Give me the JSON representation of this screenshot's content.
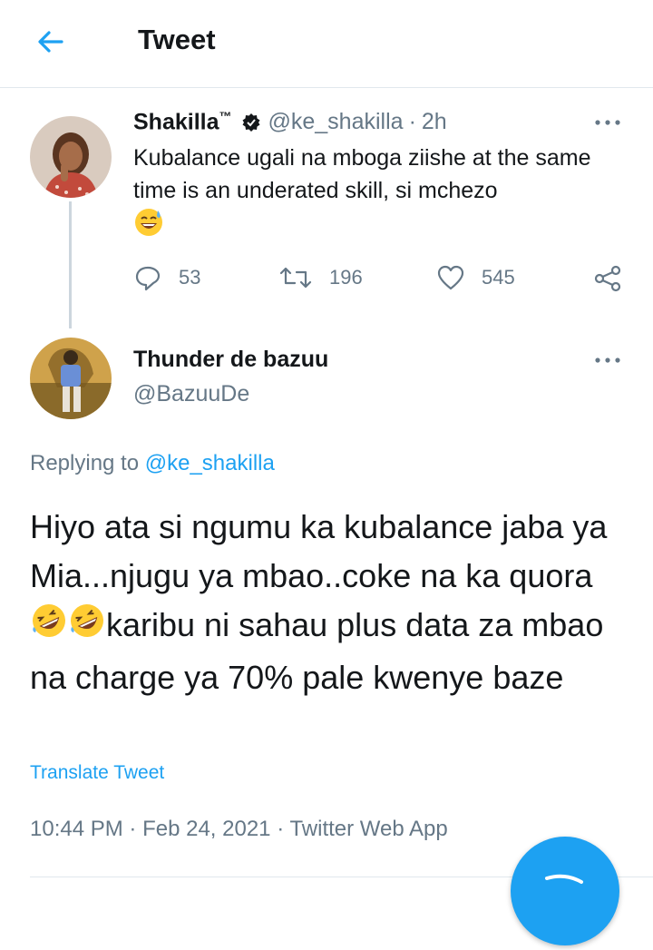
{
  "header": {
    "title": "Tweet",
    "back_icon": "arrow-left-icon"
  },
  "accent_color": "#1da1f2",
  "tweet_original": {
    "name": "Shakilla",
    "tm": "™",
    "verified_icon": "verified-badge-icon",
    "handle": "@ke_shakilla",
    "separator": "·",
    "time": "2h",
    "text": "Kubalance ugali na mboga ziishe at the same time is an underated skill, si mchezo",
    "emoji": "sweat-smile-emoji",
    "replies": "53",
    "retweets": "196",
    "likes": "545"
  },
  "tweet_reply": {
    "name": "Thunder de bazuu",
    "handle": "@BazuuDe",
    "replying_prefix": "Replying to",
    "replying_handle": "@ke_shakilla",
    "text_part1": "Hiyo ata si ngumu ka kubalance jaba ya Mia...njugu ya mbao..coke na ka quora",
    "text_part2": "karibu ni sahau plus data za mbao na charge ya 70% pale kwenye baze",
    "emoji": "rolling-on-floor-laughing-emoji",
    "translate": "Translate Tweet",
    "time": "10:44 PM",
    "date": "Feb 24, 2021",
    "source": "Twitter Web App",
    "dot": "·"
  }
}
